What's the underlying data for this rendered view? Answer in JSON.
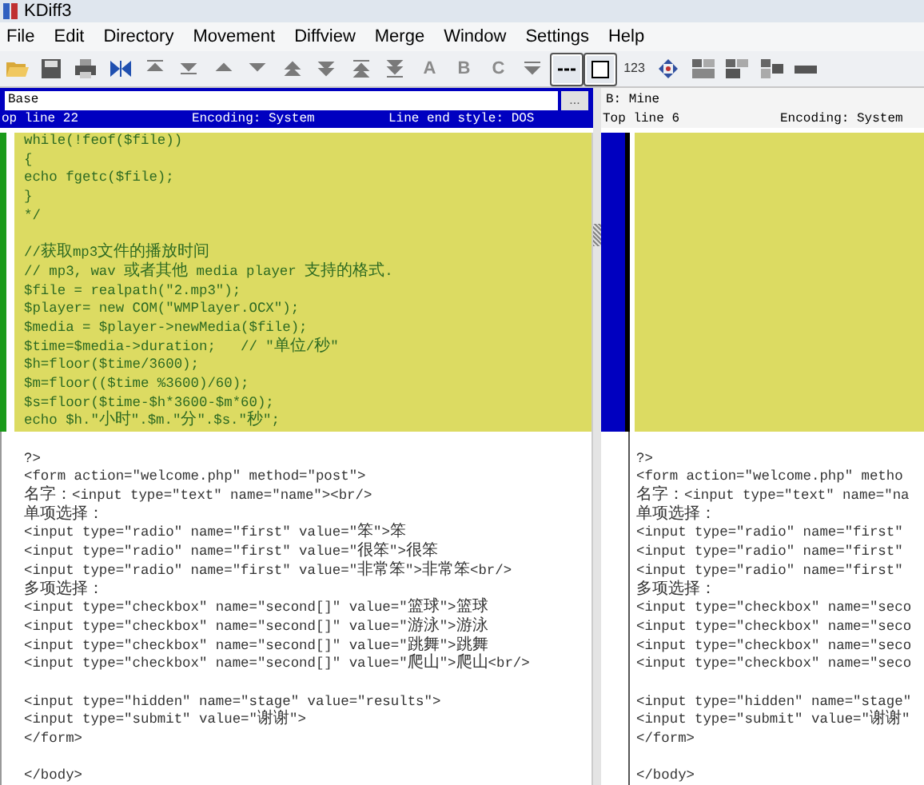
{
  "window": {
    "title": "KDiff3"
  },
  "menu": [
    "File",
    "Edit",
    "Directory",
    "Movement",
    "Diffview",
    "Merge",
    "Window",
    "Settings",
    "Help"
  ],
  "toolbar": {
    "letters": [
      "A",
      "B",
      "C"
    ],
    "number": "123",
    "toggles": [
      {
        "kind": "dashes",
        "pressed": true
      },
      {
        "kind": "square",
        "pressed": true
      }
    ]
  },
  "left_pane": {
    "selected": true,
    "input_value": "Base",
    "browse_button": "...",
    "info": [
      "op line 22",
      "Encoding: System",
      "Line end style: DOS"
    ],
    "lines": [
      {
        "text": "while(!feof($file))",
        "changed": true
      },
      {
        "text": "{",
        "changed": true
      },
      {
        "text": "echo fgetc($file);",
        "changed": true
      },
      {
        "text": "}",
        "changed": true
      },
      {
        "text": "*/",
        "changed": true
      },
      {
        "changed": true
      },
      {
        "text": "//获取mp3文件的播放时间",
        "changed": true
      },
      {
        "text": "// mp3, wav 或者其他 media player 支持的格式.",
        "changed": true
      },
      {
        "text": "$file = realpath(\"2.mp3\");",
        "changed": true
      },
      {
        "text": "$player= new COM(\"WMPlayer.OCX\");",
        "changed": true
      },
      {
        "text": "$media = $player->newMedia($file);",
        "changed": true
      },
      {
        "text": "$time=$media->duration;   // \"单位/秒\"",
        "changed": true
      },
      {
        "text": "$h=floor($time/3600);",
        "changed": true
      },
      {
        "text": "$m=floor(($time %3600)/60);",
        "changed": true
      },
      {
        "text": "$s=floor($time-$h*3600-$m*60);",
        "changed": true
      },
      {
        "text": "echo $h.\"小时\".$m.\"分\".$s.\"秒\";",
        "changed": true
      },
      {
        "changed": false
      },
      {
        "text": "?>",
        "changed": false
      },
      {
        "text": "<form action=\"welcome.php\" method=\"post\">",
        "changed": false
      },
      {
        "text": "名字：<input type=\"text\" name=\"name\"><br/>",
        "changed": false
      },
      {
        "text": "单项选择：",
        "changed": false
      },
      {
        "text": "<input type=\"radio\" name=\"first\" value=\"笨\">笨",
        "changed": false
      },
      {
        "text": "<input type=\"radio\" name=\"first\" value=\"很笨\">很笨",
        "changed": false
      },
      {
        "text": "<input type=\"radio\" name=\"first\" value=\"非常笨\">非常笨<br/>",
        "changed": false
      },
      {
        "text": "多项选择：",
        "changed": false
      },
      {
        "text": "<input type=\"checkbox\" name=\"second[]\" value=\"篮球\">篮球",
        "changed": false
      },
      {
        "text": "<input type=\"checkbox\" name=\"second[]\" value=\"游泳\">游泳",
        "changed": false
      },
      {
        "text": "<input type=\"checkbox\" name=\"second[]\" value=\"跳舞\">跳舞",
        "changed": false
      },
      {
        "text": "<input type=\"checkbox\" name=\"second[]\" value=\"爬山\">爬山<br/>",
        "changed": false
      },
      {
        "changed": false
      },
      {
        "text": "<input type=\"hidden\" name=\"stage\" value=\"results\">",
        "changed": false
      },
      {
        "text": "<input type=\"submit\" value=\"谢谢\">",
        "changed": false
      },
      {
        "text": "</form>",
        "changed": false
      },
      {
        "changed": false
      },
      {
        "text": "</body>",
        "changed": false
      }
    ]
  },
  "right_pane": {
    "selected": false,
    "title": "B: Mine",
    "info": [
      "Top line 6",
      "Encoding: System"
    ],
    "lines": [
      {
        "changed": true
      },
      {
        "changed": true
      },
      {
        "changed": true
      },
      {
        "changed": true
      },
      {
        "changed": true
      },
      {
        "changed": true
      },
      {
        "changed": true
      },
      {
        "changed": true
      },
      {
        "changed": true
      },
      {
        "changed": true
      },
      {
        "changed": true
      },
      {
        "changed": true
      },
      {
        "changed": true
      },
      {
        "changed": true
      },
      {
        "changed": true
      },
      {
        "changed": true
      },
      {
        "changed": false
      },
      {
        "text": "?>",
        "changed": false
      },
      {
        "text": "<form action=\"welcome.php\" metho",
        "changed": false
      },
      {
        "text": "名字：<input type=\"text\" name=\"na",
        "changed": false
      },
      {
        "text": "单项选择：",
        "changed": false
      },
      {
        "text": "<input type=\"radio\" name=\"first\"",
        "changed": false
      },
      {
        "text": "<input type=\"radio\" name=\"first\"",
        "changed": false
      },
      {
        "text": "<input type=\"radio\" name=\"first\"",
        "changed": false
      },
      {
        "text": "多项选择：",
        "changed": false
      },
      {
        "text": "<input type=\"checkbox\" name=\"seco",
        "changed": false
      },
      {
        "text": "<input type=\"checkbox\" name=\"seco",
        "changed": false
      },
      {
        "text": "<input type=\"checkbox\" name=\"seco",
        "changed": false
      },
      {
        "text": "<input type=\"checkbox\" name=\"seco",
        "changed": false
      },
      {
        "changed": false
      },
      {
        "text": "<input type=\"hidden\" name=\"stage\"",
        "changed": false
      },
      {
        "text": "<input type=\"submit\" value=\"谢谢\"",
        "changed": false
      },
      {
        "text": "</form>",
        "changed": false
      },
      {
        "changed": false
      },
      {
        "text": "</body>",
        "changed": false
      }
    ]
  }
}
